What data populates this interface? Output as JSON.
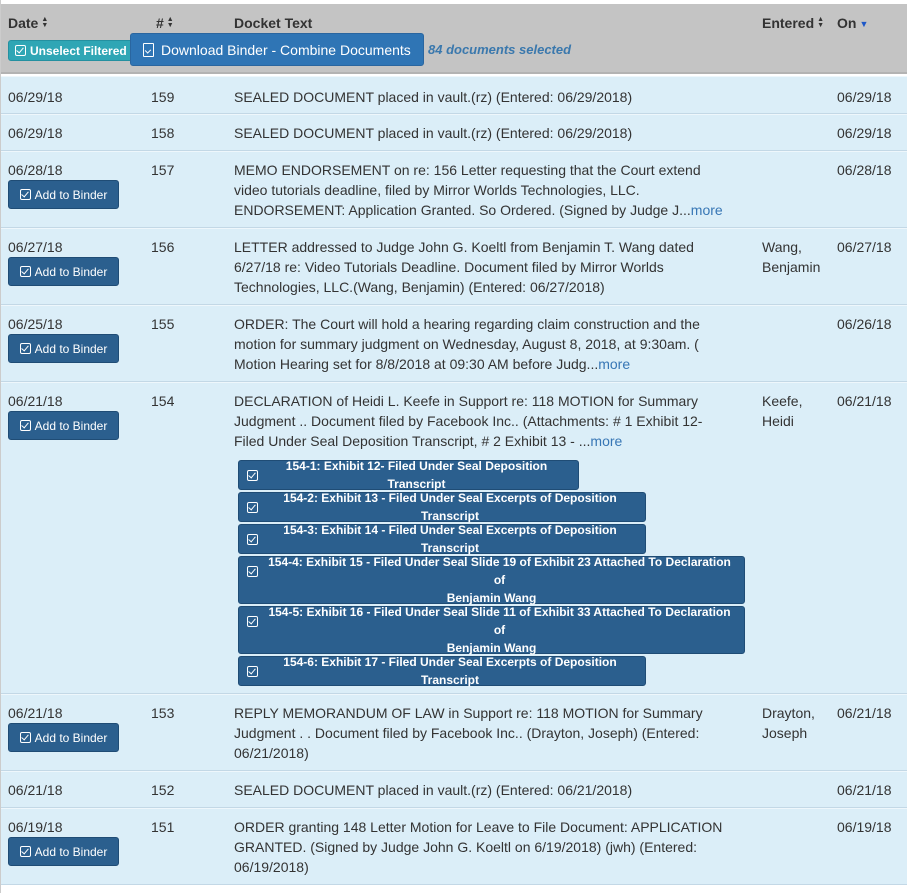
{
  "header": {
    "col_date": "Date",
    "col_num": "#",
    "col_text": "Docket Text",
    "col_entered": "Entered",
    "col_on": "On",
    "unselect_label": "Unselect Filtered",
    "download_label": "Download Binder - Combine Documents",
    "selected_count": "84 documents selected"
  },
  "add_label": "Add to Binder",
  "more_label": "more",
  "colors": {
    "header_bg": "#c4c4c4",
    "row_bg": "#dbeef8",
    "button_dark": "#2b5f8e",
    "button_teal": "#2fa6b5",
    "button_blue": "#2f75b5",
    "link": "#3776b5"
  },
  "rows": [
    {
      "date": "06/29/18",
      "num": "159",
      "text": "SEALED DOCUMENT placed in vault.(rz) (Entered: 06/29/2018)",
      "entered": "",
      "on": "06/29/18"
    },
    {
      "date": "06/29/18",
      "num": "158",
      "text": "SEALED DOCUMENT placed in vault.(rz) (Entered: 06/29/2018)",
      "entered": "",
      "on": "06/29/18"
    },
    {
      "date": "06/28/18",
      "num": "157",
      "text_lines": [
        "MEMO ENDORSEMENT on re: 156 Letter requesting that the Court extend",
        "video tutorials deadline, filed by Mirror Worlds Technologies, LLC.",
        "ENDORSEMENT: Application Granted. So Ordered. (Signed by Judge J..."
      ],
      "entered": "",
      "on": "06/28/18"
    },
    {
      "date": "06/27/18",
      "num": "156",
      "text_lines": [
        "LETTER addressed to Judge John G. Koeltl from Benjamin T. Wang dated",
        "6/27/18 re: Video Tutorials Deadline. Document filed by Mirror Worlds",
        "Technologies, LLC.(Wang, Benjamin) (Entered: 06/27/2018)"
      ],
      "entered_lines": [
        "Wang,",
        "Benjamin"
      ],
      "on": "06/27/18"
    },
    {
      "date": "06/25/18",
      "num": "155",
      "text_lines": [
        "ORDER: The Court will hold a hearing regarding claim construction and the",
        "motion for summary judgment on Wednesday, August 8, 2018, at 9:30am. (",
        "Motion Hearing set for 8/8/2018 at 09:30 AM before Judg..."
      ],
      "entered": "",
      "on": "06/26/18"
    },
    {
      "date": "06/21/18",
      "num": "154",
      "text_lines": [
        "DECLARATION of Heidi L. Keefe in Support re: 118 MOTION for Summary",
        "Judgment .. Document filed by Facebook Inc.. (Attachments: # 1 Exhibit 12-",
        "Filed Under Seal Deposition Transcript, # 2 Exhibit 13 - ..."
      ],
      "entered_lines": [
        "Keefe,",
        "Heidi"
      ],
      "on": "06/21/18",
      "attachments": [
        {
          "label": "154-1: Exhibit 12- Filed Under Seal Deposition Transcript"
        },
        {
          "label": "154-2: Exhibit 13 - Filed Under Seal Excerpts of Deposition Transcript"
        },
        {
          "label": "154-3: Exhibit 14 - Filed Under Seal Excerpts of Deposition Transcript"
        },
        {
          "label_lines": [
            "154-4: Exhibit 15 - Filed Under Seal Slide 19 of Exhibit 23 Attached To Declaration of",
            "Benjamin Wang"
          ]
        },
        {
          "label_lines": [
            "154-5: Exhibit 16 - Filed Under Seal Slide 11 of Exhibit 33 Attached To Declaration of",
            "Benjamin Wang"
          ]
        },
        {
          "label": "154-6: Exhibit 17 - Filed Under Seal Excerpts of Deposition Transcript"
        }
      ]
    },
    {
      "date": "06/21/18",
      "num": "153",
      "text_lines": [
        "REPLY MEMORANDUM OF LAW in Support re: 118 MOTION for Summary",
        "Judgment . . Document filed by Facebook Inc.. (Drayton, Joseph) (Entered:",
        "06/21/2018)"
      ],
      "entered_lines": [
        "Drayton,",
        "Joseph"
      ],
      "on": "06/21/18"
    },
    {
      "date": "06/21/18",
      "num": "152",
      "text": "SEALED DOCUMENT placed in vault.(rz) (Entered: 06/21/2018)",
      "entered": "",
      "on": "06/21/18"
    },
    {
      "date": "06/19/18",
      "num": "151",
      "text_lines": [
        "ORDER granting 148 Letter Motion for Leave to File Document: APPLICATION",
        "GRANTED. (Signed by Judge John G. Koeltl on 6/19/2018) (jwh) (Entered:",
        "06/19/2018)"
      ],
      "entered": "",
      "on": "06/19/18"
    }
  ]
}
